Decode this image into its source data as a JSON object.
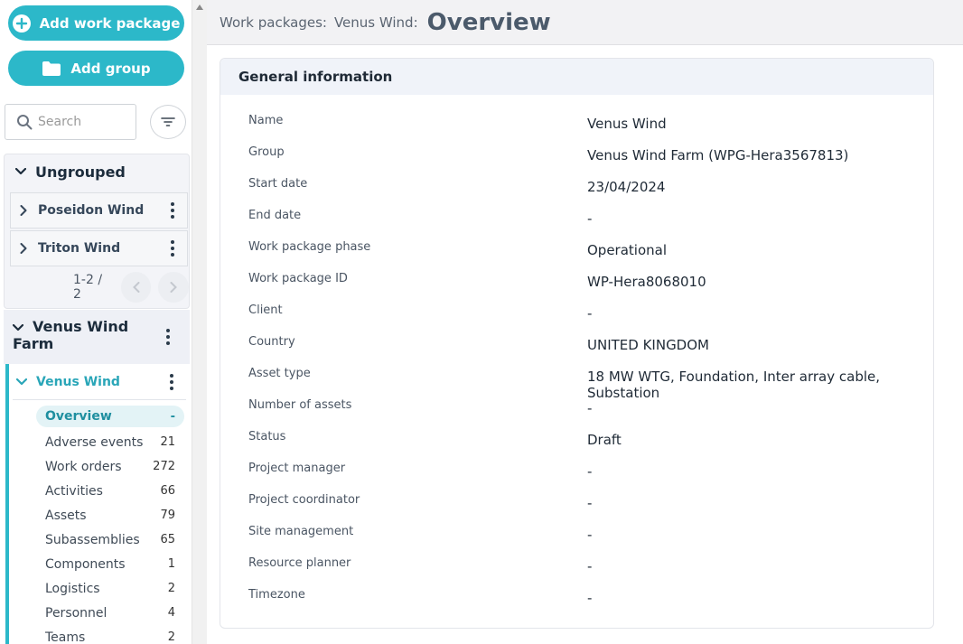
{
  "sidebar": {
    "add_work_package_label": "Add work package",
    "add_group_label": "Add group",
    "search_placeholder": "Search",
    "ungrouped": {
      "label": "Ungrouped",
      "items": [
        {
          "label": "Poseidon Wind"
        },
        {
          "label": "Triton Wind"
        }
      ],
      "pager": "1-2 / 2"
    },
    "group": {
      "label": "Venus Wind Farm",
      "work_package": {
        "label": "Venus Wind",
        "menu": [
          {
            "label": "Overview",
            "count": "-"
          },
          {
            "label": "Adverse events",
            "count": "21"
          },
          {
            "label": "Work orders",
            "count": "272"
          },
          {
            "label": "Activities",
            "count": "66"
          },
          {
            "label": "Assets",
            "count": "79"
          },
          {
            "label": "Subassemblies",
            "count": "65"
          },
          {
            "label": "Components",
            "count": "1"
          },
          {
            "label": "Logistics",
            "count": "2"
          },
          {
            "label": "Personnel",
            "count": "4"
          },
          {
            "label": "Teams",
            "count": "2"
          }
        ]
      }
    }
  },
  "header": {
    "crumb1": "Work packages:",
    "crumb2": "Venus Wind:",
    "title": "Overview"
  },
  "general_info": {
    "title": "General information",
    "rows": [
      {
        "label": "Name",
        "value": "Venus Wind"
      },
      {
        "label": "Group",
        "value": "Venus Wind Farm (WPG-Hera3567813)"
      },
      {
        "label": "Start date",
        "value": "23/04/2024"
      },
      {
        "label": "End date",
        "value": "-"
      },
      {
        "label": "Work package phase",
        "value": "Operational"
      },
      {
        "label": "Work package ID",
        "value": "WP-Hera8068010"
      },
      {
        "label": "Client",
        "value": "-"
      },
      {
        "label": "Country",
        "value": "UNITED KINGDOM"
      },
      {
        "label": "Asset type",
        "value": "18 MW WTG, Foundation, Inter array cable, Substation"
      },
      {
        "label": "Number of assets",
        "value": "-"
      },
      {
        "label": "Status",
        "value": "Draft"
      },
      {
        "label": "Project manager",
        "value": "-"
      },
      {
        "label": "Project coordinator",
        "value": "-"
      },
      {
        "label": "Site management",
        "value": "-"
      },
      {
        "label": "Resource planner",
        "value": "-"
      },
      {
        "label": "Timezone",
        "value": "-"
      }
    ]
  },
  "colors": {
    "accent": "#2cb8c9",
    "title": "#4b5a6b"
  }
}
